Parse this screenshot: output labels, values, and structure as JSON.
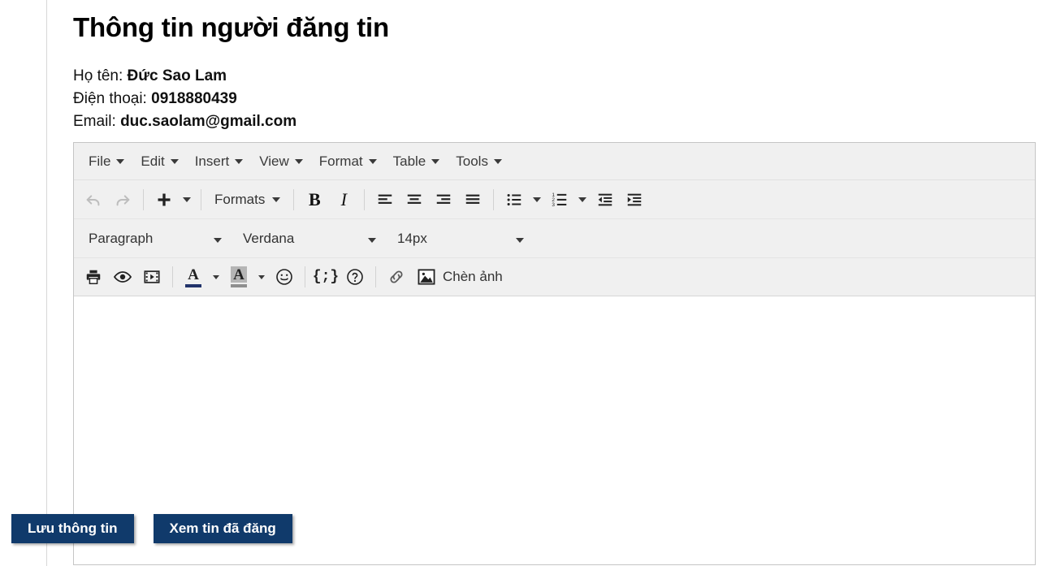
{
  "page": {
    "title": "Thông tin người đăng tin"
  },
  "contact": {
    "rows": [
      {
        "label": "Họ tên: ",
        "value": "Đức Sao Lam"
      },
      {
        "label": "Điện thoại: ",
        "value": "0918880439"
      },
      {
        "label": "Email: ",
        "value": "duc.saolam@gmail.com"
      }
    ]
  },
  "editor": {
    "menubar": [
      {
        "label": "File",
        "icon": "chevron-down-icon"
      },
      {
        "label": "Edit",
        "icon": "chevron-down-icon"
      },
      {
        "label": "Insert",
        "icon": "chevron-down-icon"
      },
      {
        "label": "View",
        "icon": "chevron-down-icon"
      },
      {
        "label": "Format",
        "icon": "chevron-down-icon"
      },
      {
        "label": "Table",
        "icon": "chevron-down-icon"
      },
      {
        "label": "Tools",
        "icon": "chevron-down-icon"
      }
    ],
    "toolbar_row1": {
      "undo": "undo-icon",
      "redo": "redo-icon",
      "insert_plus": "plus-icon",
      "formats_label": "Formats",
      "bold_label": "B",
      "italic_label": "I",
      "align_left": "align-left-icon",
      "align_center": "align-center-icon",
      "align_right": "align-right-icon",
      "align_justify": "align-justify-icon",
      "bullet_list": "bullet-list-icon",
      "numbered_list": "numbered-list-icon",
      "outdent": "outdent-icon",
      "indent": "indent-icon"
    },
    "toolbar_row2": {
      "block_format": "Paragraph",
      "font_family": "Verdana",
      "font_size": "14px"
    },
    "toolbar_row3": {
      "print": "print-icon",
      "preview": "eye-icon",
      "media": "film-icon",
      "text_color": "text-color-icon",
      "background_color": "background-color-icon",
      "emoticon": "smiley-icon",
      "source_code": "source-code-icon",
      "help": "help-icon",
      "link": "link-icon",
      "image_button_label": "Chèn ảnh",
      "image_button_icon": "image-icon"
    },
    "content": ""
  },
  "actions": {
    "save_label": "Lưu thông tin",
    "view_label": "Xem tin đã đăng"
  },
  "colors": {
    "primary_button": "#103a6b",
    "toolbar_bg": "#f0f0f0",
    "text_color_swatch": "#22336b",
    "background_color_swatch": "#b5b5b5"
  }
}
